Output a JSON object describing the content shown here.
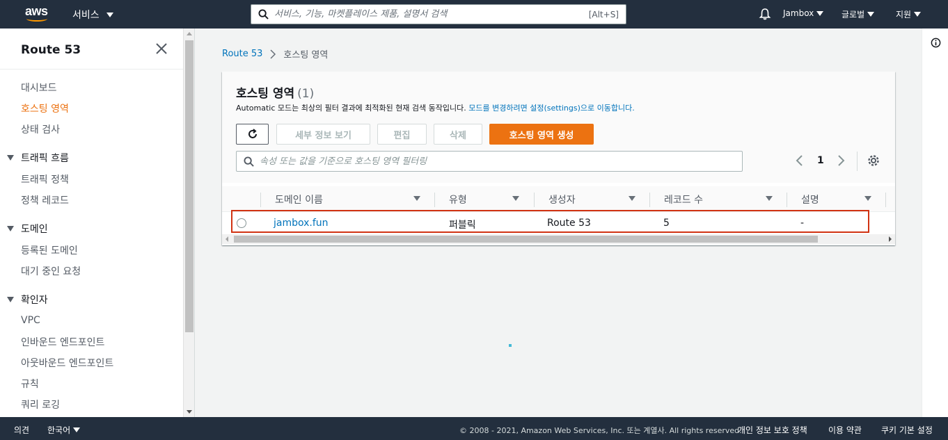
{
  "topnav": {
    "logo_text": "aws",
    "services_label": "서비스",
    "search_placeholder": "서비스, 기능, 마켓플레이스 제품, 설명서 검색",
    "search_shortcut": "[Alt+S]",
    "account_label": "Jambox",
    "region_label": "글로벌",
    "support_label": "지원"
  },
  "sidebar": {
    "title": "Route 53",
    "links_top": [
      "대시보드",
      "호스팅 영역",
      "상태 검사"
    ],
    "active_link": "호스팅 영역",
    "sections": [
      {
        "title": "트래픽 흐름",
        "items": [
          "트래픽 정책",
          "정책 레코드"
        ]
      },
      {
        "title": "도메인",
        "items": [
          "등록된 도메인",
          "대기 중인 요청"
        ]
      },
      {
        "title": "확인자",
        "items": [
          "VPC",
          "인바운드 엔드포인트",
          "아웃바운드 엔드포인트",
          "규칙",
          "쿼리 로깅"
        ]
      }
    ]
  },
  "breadcrumb": {
    "root": "Route 53",
    "current": "호스팅 영역"
  },
  "panel": {
    "title": "호스팅 영역",
    "count": "(1)",
    "desc_prefix": "Automatic 모드는 최상의 필터 결과에 최적화된 현재 검색 동작입니다.",
    "desc_link": "모드를 변경하려면 설정(settings)으로 이동합니다.",
    "buttons": {
      "details": "세부 정보 보기",
      "edit": "편집",
      "delete": "삭제",
      "create": "호스팅 영역 생성"
    },
    "filter_placeholder": "속성 또는 값을 기준으로 호스팅 영역 필터링",
    "page_number": "1"
  },
  "table": {
    "columns": [
      "도메인 이름",
      "유형",
      "생성자",
      "레코드 수",
      "설명"
    ],
    "rows": [
      {
        "domain": "jambox.fun",
        "type": "퍼블릭",
        "created_by": "Route 53",
        "record_count": "5",
        "description": "-"
      }
    ]
  },
  "colors": {
    "nav_bg": "#232f3e",
    "accent": "#ec7211",
    "link": "#0073bb",
    "highlight": "#d13212"
  },
  "footer": {
    "feedback": "의견",
    "language": "한국어",
    "copyright": "© 2008 - 2021, Amazon Web Services, Inc. 또는 계열사. All rights reserved.",
    "privacy": "개인 정보 보호 정책",
    "terms": "이용 약관",
    "cookies": "쿠키 기본 설정"
  }
}
